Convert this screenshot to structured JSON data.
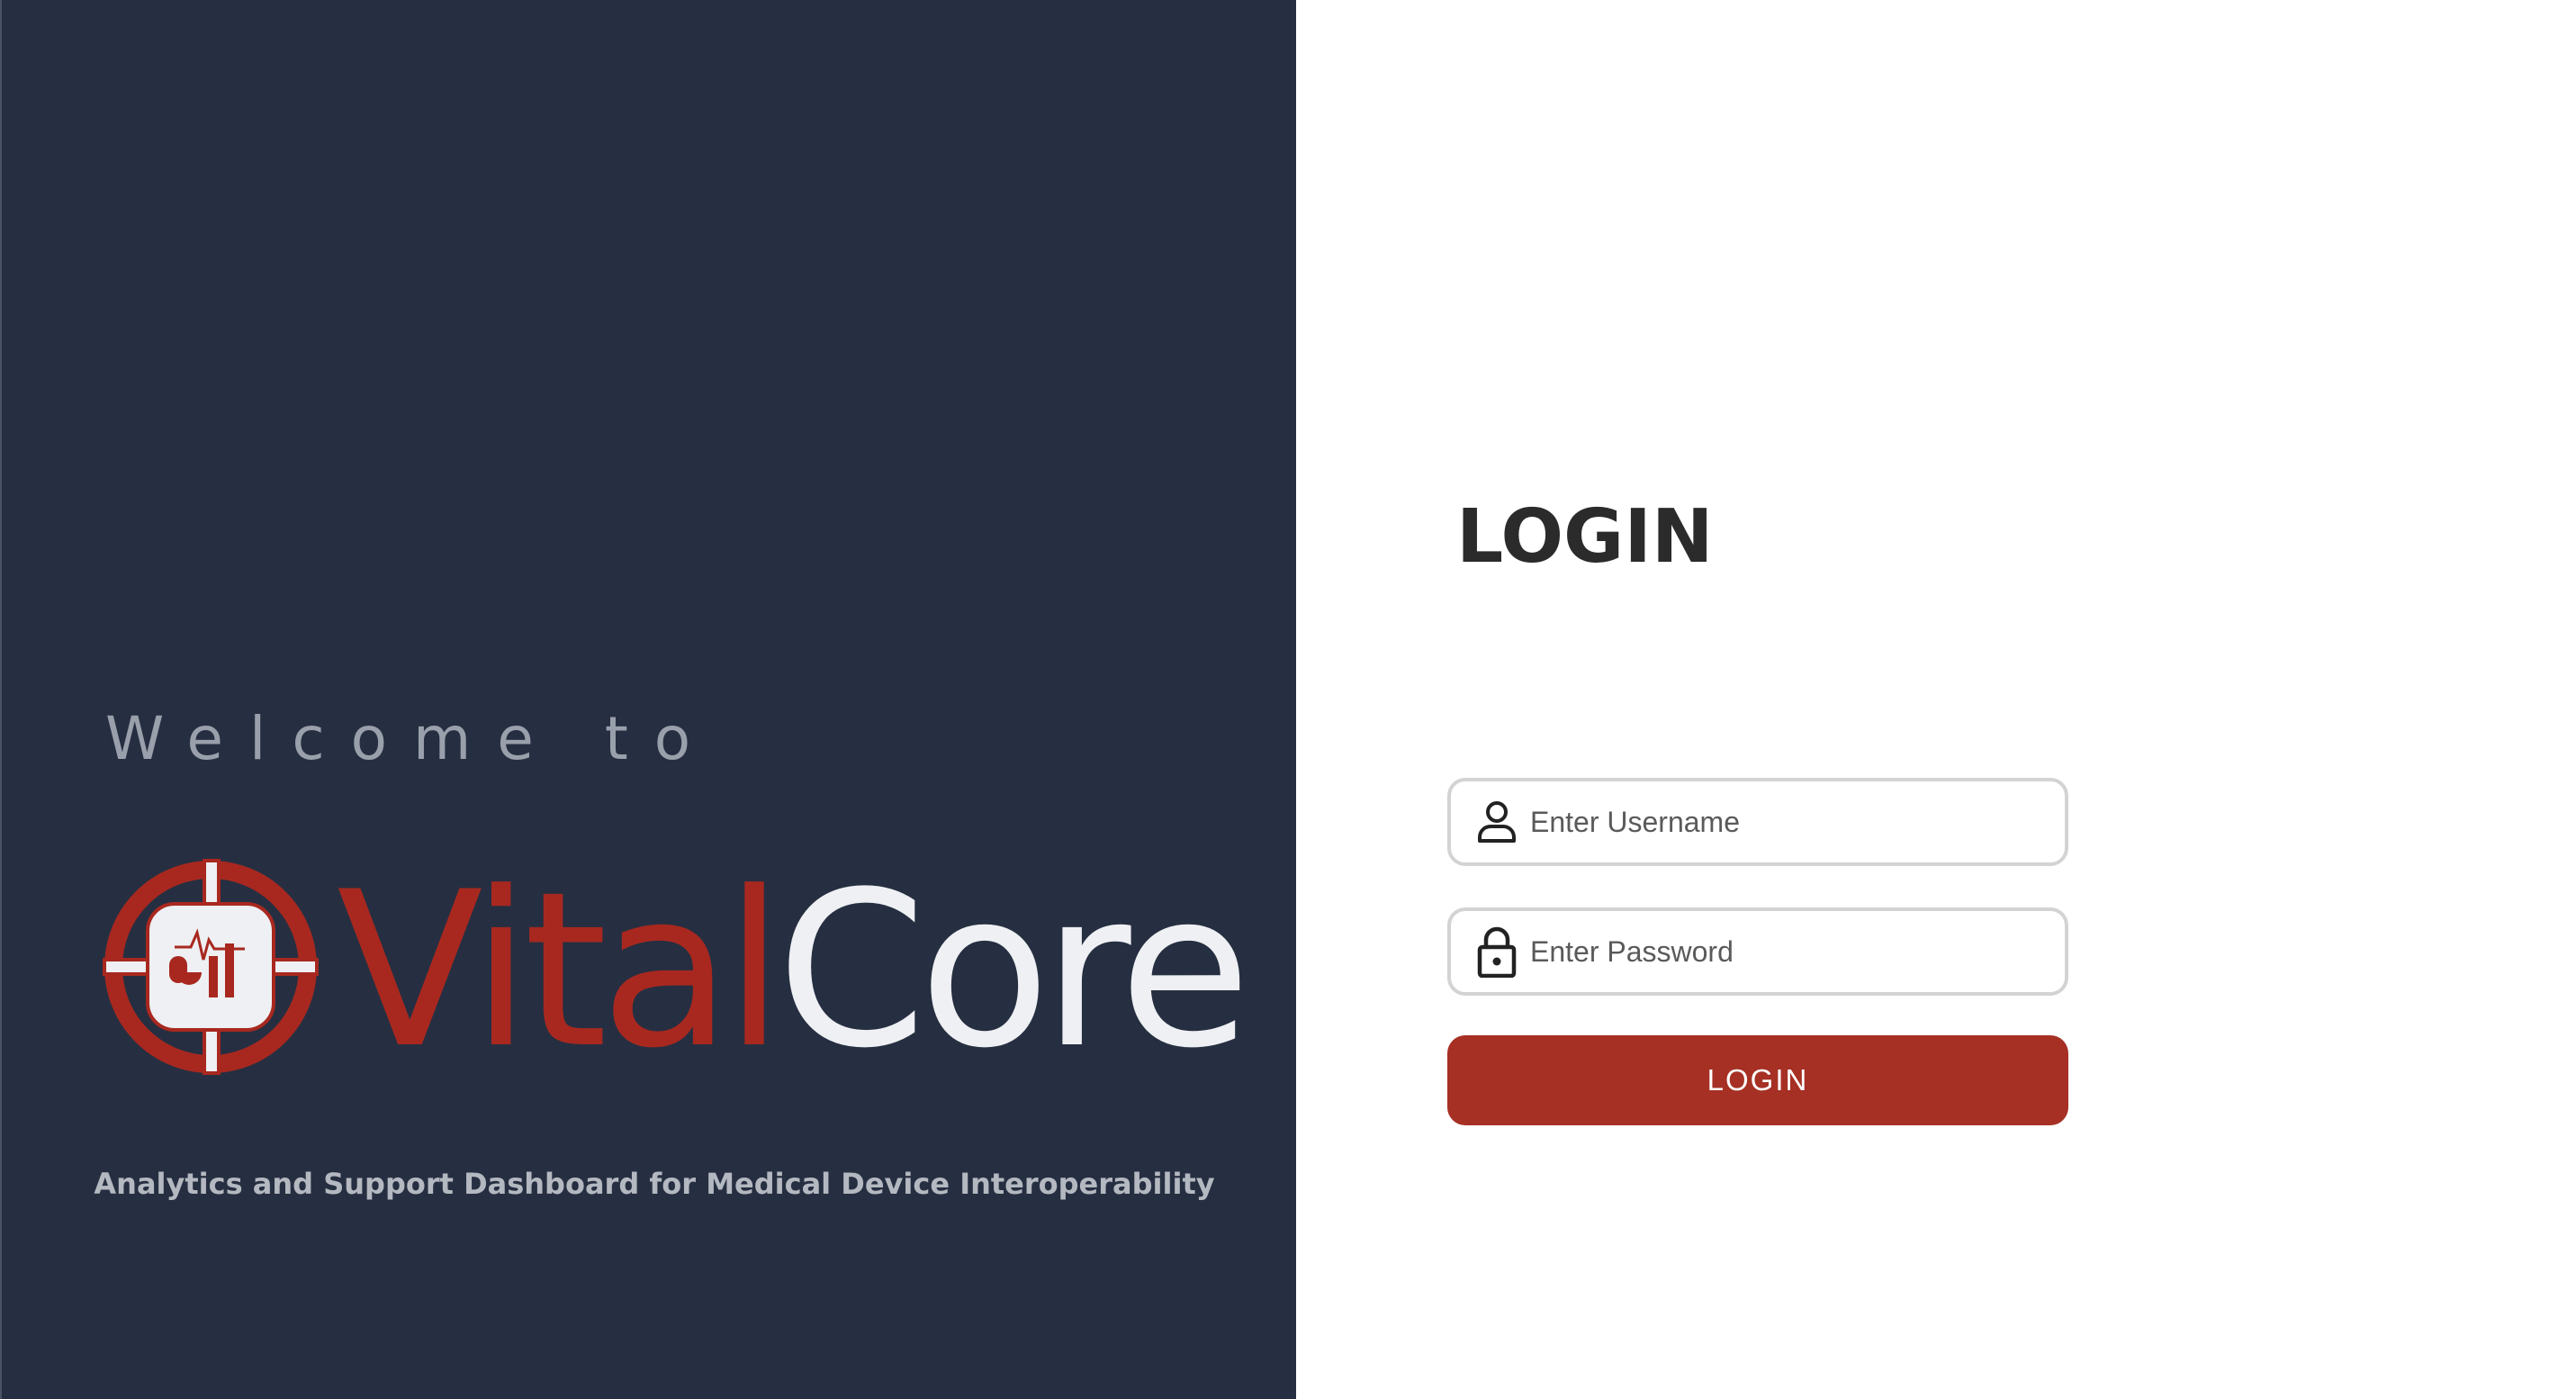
{
  "left_panel": {
    "welcome_text": "Welcome to",
    "brand": {
      "part1": "Vital",
      "part2": "Core"
    },
    "tagline": "Analytics and Support Dashboard for Medical Device Interoperability",
    "logo_icon": "vitalcore-crosshair-logo"
  },
  "login": {
    "title": "LOGIN",
    "username": {
      "placeholder": "Enter Username",
      "value": "",
      "icon": "user-icon"
    },
    "password": {
      "placeholder": "Enter Password",
      "value": "",
      "icon": "lock-icon"
    },
    "button_label": "LOGIN"
  },
  "colors": {
    "panel_bg": "#262f41",
    "brand_red": "#a8281f",
    "button_red": "#a63024",
    "wordmark_light": "#eef0f3"
  }
}
